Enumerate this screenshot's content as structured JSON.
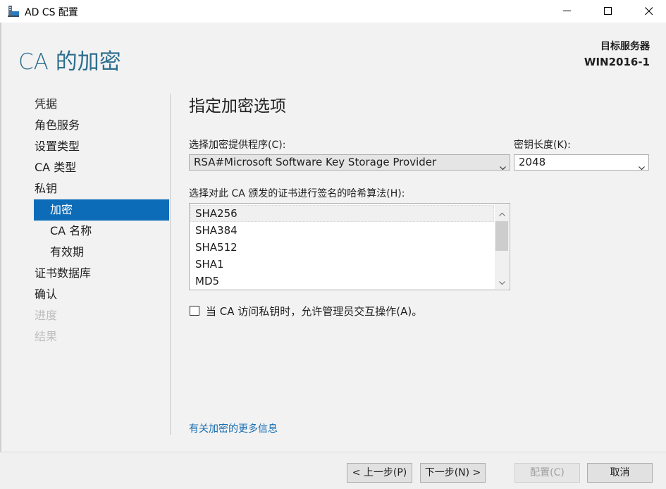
{
  "window": {
    "title": "AD CS 配置",
    "controls": [
      "minimize-icon",
      "maximize-icon",
      "close-icon"
    ]
  },
  "header": {
    "title": "CA 的加密",
    "target_server_label": "目标服务器",
    "target_server_name": "WIN2016-1"
  },
  "nav": {
    "items": [
      {
        "label": "凭据",
        "state": "normal"
      },
      {
        "label": "角色服务",
        "state": "normal"
      },
      {
        "label": "设置类型",
        "state": "normal"
      },
      {
        "label": "CA 类型",
        "state": "normal"
      },
      {
        "label": "私钥",
        "state": "normal"
      },
      {
        "label": "加密",
        "state": "active"
      },
      {
        "label": "CA 名称",
        "state": "normal"
      },
      {
        "label": "有效期",
        "state": "normal"
      },
      {
        "label": "证书数据库",
        "state": "normal"
      },
      {
        "label": "确认",
        "state": "normal"
      },
      {
        "label": "进度",
        "state": "disabled"
      },
      {
        "label": "结果",
        "state": "disabled"
      }
    ]
  },
  "content": {
    "section_title": "指定加密选项",
    "provider_label": "选择加密提供程序(C):",
    "provider_value": "RSA#Microsoft Software Key Storage Provider",
    "key_length_label": "密钥长度(K):",
    "key_length_value": "2048",
    "hash_label": "选择对此 CA 颁发的证书进行签名的哈希算法(H):",
    "hash_items": [
      "SHA256",
      "SHA384",
      "SHA512",
      "SHA1",
      "MD5"
    ],
    "hash_selected": "SHA256",
    "admin_interaction_label": "当 CA 访问私钥时，允许管理员交互操作(A)。",
    "admin_interaction_checked": false,
    "more_info_link": "有关加密的更多信息"
  },
  "footer": {
    "back_label": "< 上一步(P)",
    "next_label": "下一步(N) >",
    "configure_label": "配置(C)",
    "cancel_label": "取消"
  },
  "colors": {
    "accent": "#0c6cb8",
    "header_title": "#2d6e8e",
    "link": "#1a6fb0"
  }
}
